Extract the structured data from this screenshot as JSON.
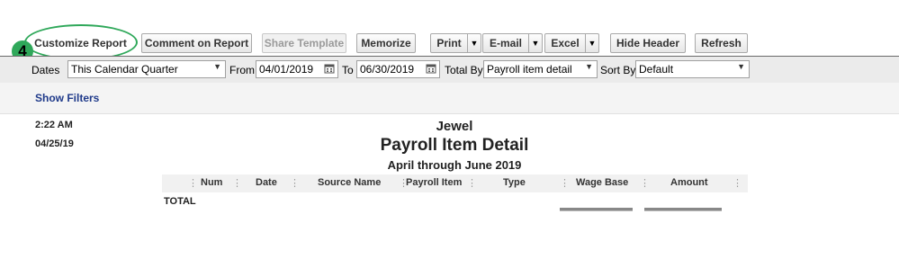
{
  "toolbar": {
    "customize_report": "Customize Report",
    "comment_on_report": "Comment on Report",
    "share_template": "Share Template",
    "memorize": "Memorize",
    "print": "Print",
    "email": "E-mail",
    "excel": "Excel",
    "hide_header": "Hide Header",
    "refresh": "Refresh"
  },
  "step_badge": "4",
  "filters": {
    "dates_label": "Dates",
    "dates_value": "This Calendar Quarter",
    "from_label": "From",
    "from_value": "04/01/2019",
    "to_label": "To",
    "to_value": "06/30/2019",
    "total_by_label": "Total By",
    "total_by_value": "Payroll item detail",
    "sort_by_label": "Sort By",
    "sort_by_value": "Default"
  },
  "show_filters": "Show Filters",
  "report": {
    "time": "2:22 AM",
    "date": "04/25/19",
    "company": "Jewel",
    "title": "Payroll Item Detail",
    "period": "April through June 2019",
    "columns": [
      "Num",
      "Date",
      "Source Name",
      "Payroll Item",
      "Type",
      "Wage Base",
      "Amount"
    ],
    "total_label": "TOTAL"
  },
  "icons": [
    "calendar-icon",
    "dropdown-arrow-icon"
  ],
  "colors": {
    "highlight": "#2fa85a",
    "link": "#1f3a8a"
  }
}
